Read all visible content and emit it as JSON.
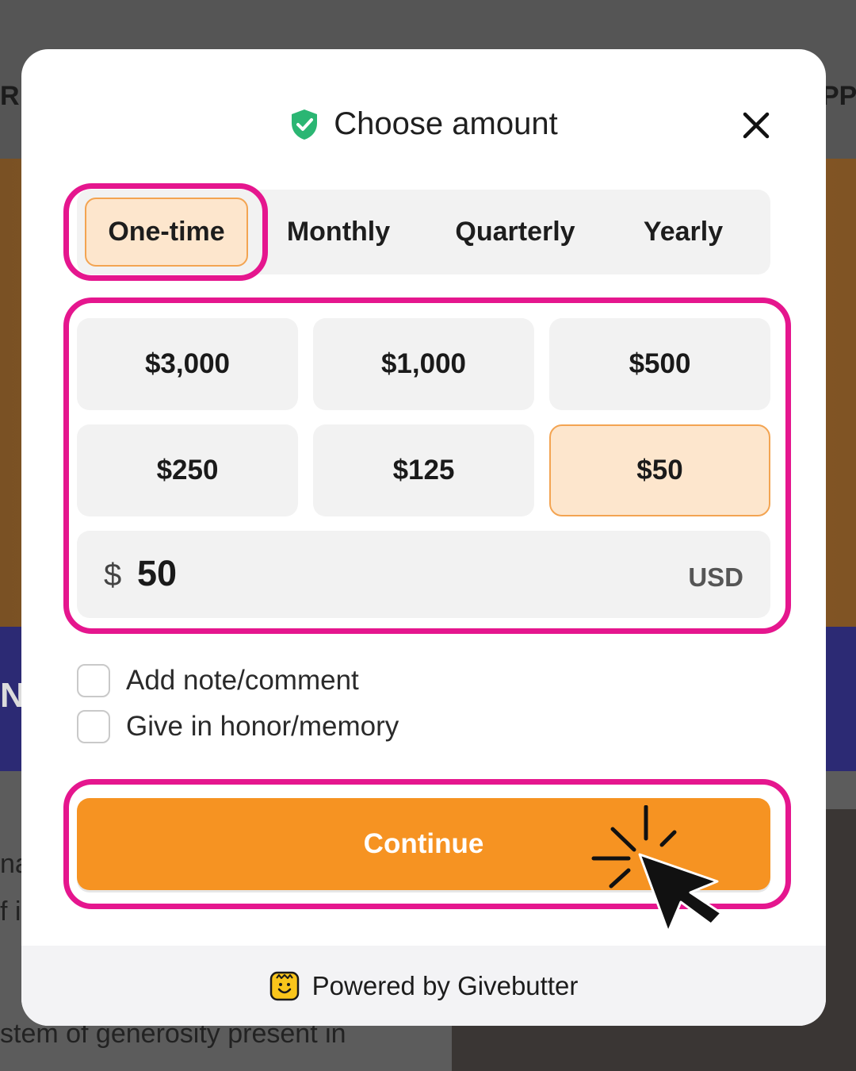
{
  "background": {
    "left_fragment_top": "R",
    "right_fragment_top": "PP",
    "left_fragment_mid": "N",
    "left_fragment_lower_1": "na",
    "left_fragment_lower_2": "f i",
    "bottom_text": "stem of generosity present in"
  },
  "modal": {
    "title": "Choose amount",
    "icons": {
      "title": "shield-check-icon",
      "close": "close-icon"
    },
    "frequency_tabs": [
      {
        "label": "One-time",
        "selected": true
      },
      {
        "label": "Monthly",
        "selected": false
      },
      {
        "label": "Quarterly",
        "selected": false
      },
      {
        "label": "Yearly",
        "selected": false
      }
    ],
    "amounts": [
      {
        "label": "$3,000",
        "selected": false
      },
      {
        "label": "$1,000",
        "selected": false
      },
      {
        "label": "$500",
        "selected": false
      },
      {
        "label": "$250",
        "selected": false
      },
      {
        "label": "$125",
        "selected": false
      },
      {
        "label": "$50",
        "selected": true
      }
    ],
    "amount_input": {
      "symbol": "$",
      "value": "50",
      "currency": "USD"
    },
    "options": [
      {
        "label": "Add note/comment",
        "checked": false
      },
      {
        "label": "Give in honor/memory",
        "checked": false
      }
    ],
    "continue_label": "Continue",
    "footer": {
      "text": "Powered by Givebutter",
      "icon": "givebutter-logo-icon"
    }
  },
  "colors": {
    "accent": "#f69322",
    "selected_fill": "#fde6cd",
    "selected_border": "#f3a452",
    "highlight": "#e5168e",
    "shield": "#2bb673"
  }
}
